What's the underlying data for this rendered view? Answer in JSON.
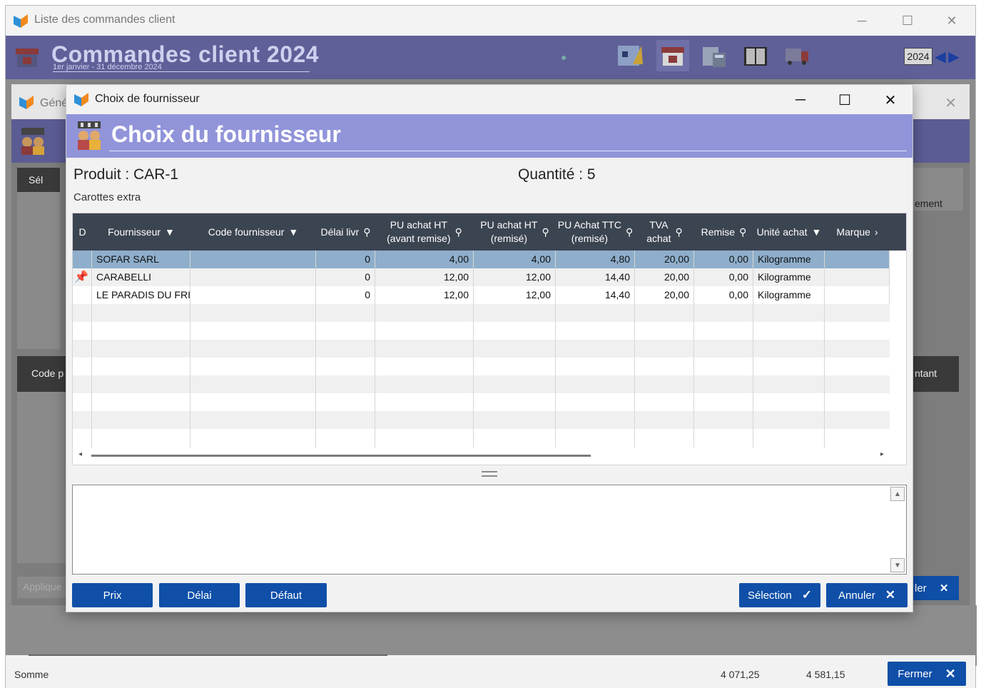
{
  "main_window": {
    "title": "Liste des commandes client",
    "header_title": "Commandes client 2024",
    "period": "1er janvier - 31 décembre 2024",
    "year": "2024",
    "bottom_label": "Somme",
    "total_1": "4 071,25",
    "total_2": "4 581,15",
    "close_label": "Fermer"
  },
  "behind_window": {
    "title_fragment": "Géné",
    "col_sel": "Sél",
    "col_code": "Code p",
    "col_montant": "ntant",
    "col_reglement": "ement",
    "apply_label": "Applique",
    "cancel_fragment": "ler"
  },
  "dialog": {
    "title": "Choix de fournisseur",
    "header_title": "Choix du fournisseur",
    "product_label": "Produit : CAR-1",
    "quantity_label": "Quantité : 5",
    "product_description": "Carottes extra",
    "columns": [
      {
        "label": "D"
      },
      {
        "label": "Fournisseur"
      },
      {
        "label": "Code fournisseur"
      },
      {
        "label": "Délai livr"
      },
      {
        "label": "PU achat HT\n(avant remise)"
      },
      {
        "label": "PU achat HT\n(remisé)"
      },
      {
        "label": "PU Achat TTC\n(remisé)"
      },
      {
        "label": "TVA\nachat"
      },
      {
        "label": "Remise"
      },
      {
        "label": "Unité achat"
      },
      {
        "label": "Marque"
      }
    ],
    "rows": [
      {
        "default": false,
        "fournisseur": "SOFAR SARL",
        "code": "",
        "delai": "0",
        "pu_ht_avant": "4,00",
        "pu_ht_remise": "4,00",
        "pu_ttc": "4,80",
        "tva": "20,00",
        "remise": "0,00",
        "unite": "Kilogramme",
        "marque": ""
      },
      {
        "default": true,
        "fournisseur": "CARABELLI",
        "code": "",
        "delai": "0",
        "pu_ht_avant": "12,00",
        "pu_ht_remise": "12,00",
        "pu_ttc": "14,40",
        "tva": "20,00",
        "remise": "0,00",
        "unite": "Kilogramme",
        "marque": ""
      },
      {
        "default": false,
        "fournisseur": "LE PARADIS DU FRI",
        "code": "",
        "delai": "0",
        "pu_ht_avant": "12,00",
        "pu_ht_remise": "12,00",
        "pu_ttc": "14,40",
        "tva": "20,00",
        "remise": "0,00",
        "unite": "Kilogramme",
        "marque": ""
      }
    ],
    "buttons": {
      "prix": "Prix",
      "delai": "Délai",
      "defaut": "Défaut",
      "selection": "Sélection",
      "annuler": "Annuler"
    },
    "colors": {
      "header_bg": "#9194d9",
      "table_header_bg": "#3b4451",
      "selected_row": "#8eaecb",
      "button_bg": "#0f4fa8"
    }
  }
}
